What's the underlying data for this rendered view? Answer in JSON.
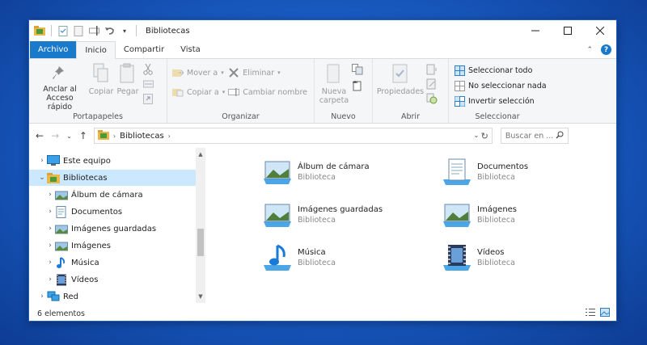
{
  "window": {
    "title": "Bibliotecas"
  },
  "tabs": [
    {
      "label": "Archivo"
    },
    {
      "label": "Inicio"
    },
    {
      "label": "Compartir"
    },
    {
      "label": "Vista"
    }
  ],
  "ribbon": {
    "portapapeles": {
      "label": "Portapapeles",
      "anclar": "Anclar al Acceso rápido",
      "copiar": "Copiar",
      "pegar": "Pegar"
    },
    "organizar": {
      "label": "Organizar",
      "mover": "Mover a",
      "copiar_a": "Copiar a",
      "eliminar": "Eliminar",
      "cambiar": "Cambiar nombre"
    },
    "nuevo": {
      "label": "Nuevo",
      "nueva_carpeta": "Nueva carpeta"
    },
    "abrir": {
      "label": "Abrir",
      "propiedades": "Propiedades"
    },
    "seleccionar": {
      "label": "Seleccionar",
      "todo": "Seleccionar todo",
      "nada": "No seleccionar nada",
      "invertir": "Invertir selección"
    }
  },
  "address": {
    "path": "Bibliotecas",
    "search_placeholder": "Buscar en ..."
  },
  "navpane": [
    {
      "label": "Este equipo",
      "icon": "computer-icon"
    },
    {
      "label": "Bibliotecas",
      "icon": "libraries-icon"
    },
    {
      "label": "Álbum de cámara",
      "icon": "picture-library-icon"
    },
    {
      "label": "Documentos",
      "icon": "documents-library-icon"
    },
    {
      "label": "Imágenes guardadas",
      "icon": "picture-library-icon"
    },
    {
      "label": "Imágenes",
      "icon": "picture-library-icon"
    },
    {
      "label": "Música",
      "icon": "music-library-icon"
    },
    {
      "label": "Vídeos",
      "icon": "video-library-icon"
    },
    {
      "label": "Red",
      "icon": "network-icon"
    }
  ],
  "libraries": [
    {
      "name": "Álbum de cámara",
      "type": "Biblioteca",
      "icon": "picture-library-icon"
    },
    {
      "name": "Documentos",
      "type": "Biblioteca",
      "icon": "documents-library-icon"
    },
    {
      "name": "Imágenes guardadas",
      "type": "Biblioteca",
      "icon": "picture-library-icon"
    },
    {
      "name": "Imágenes",
      "type": "Biblioteca",
      "icon": "picture-library-icon"
    },
    {
      "name": "Música",
      "type": "Biblioteca",
      "icon": "music-library-icon"
    },
    {
      "name": "Vídeos",
      "type": "Biblioteca",
      "icon": "video-library-icon"
    }
  ],
  "status": {
    "count": "6 elementos"
  },
  "colors": {
    "accent": "#1979ca",
    "selection": "#cce8ff",
    "ribbon_bg": "#f5f6f7"
  }
}
